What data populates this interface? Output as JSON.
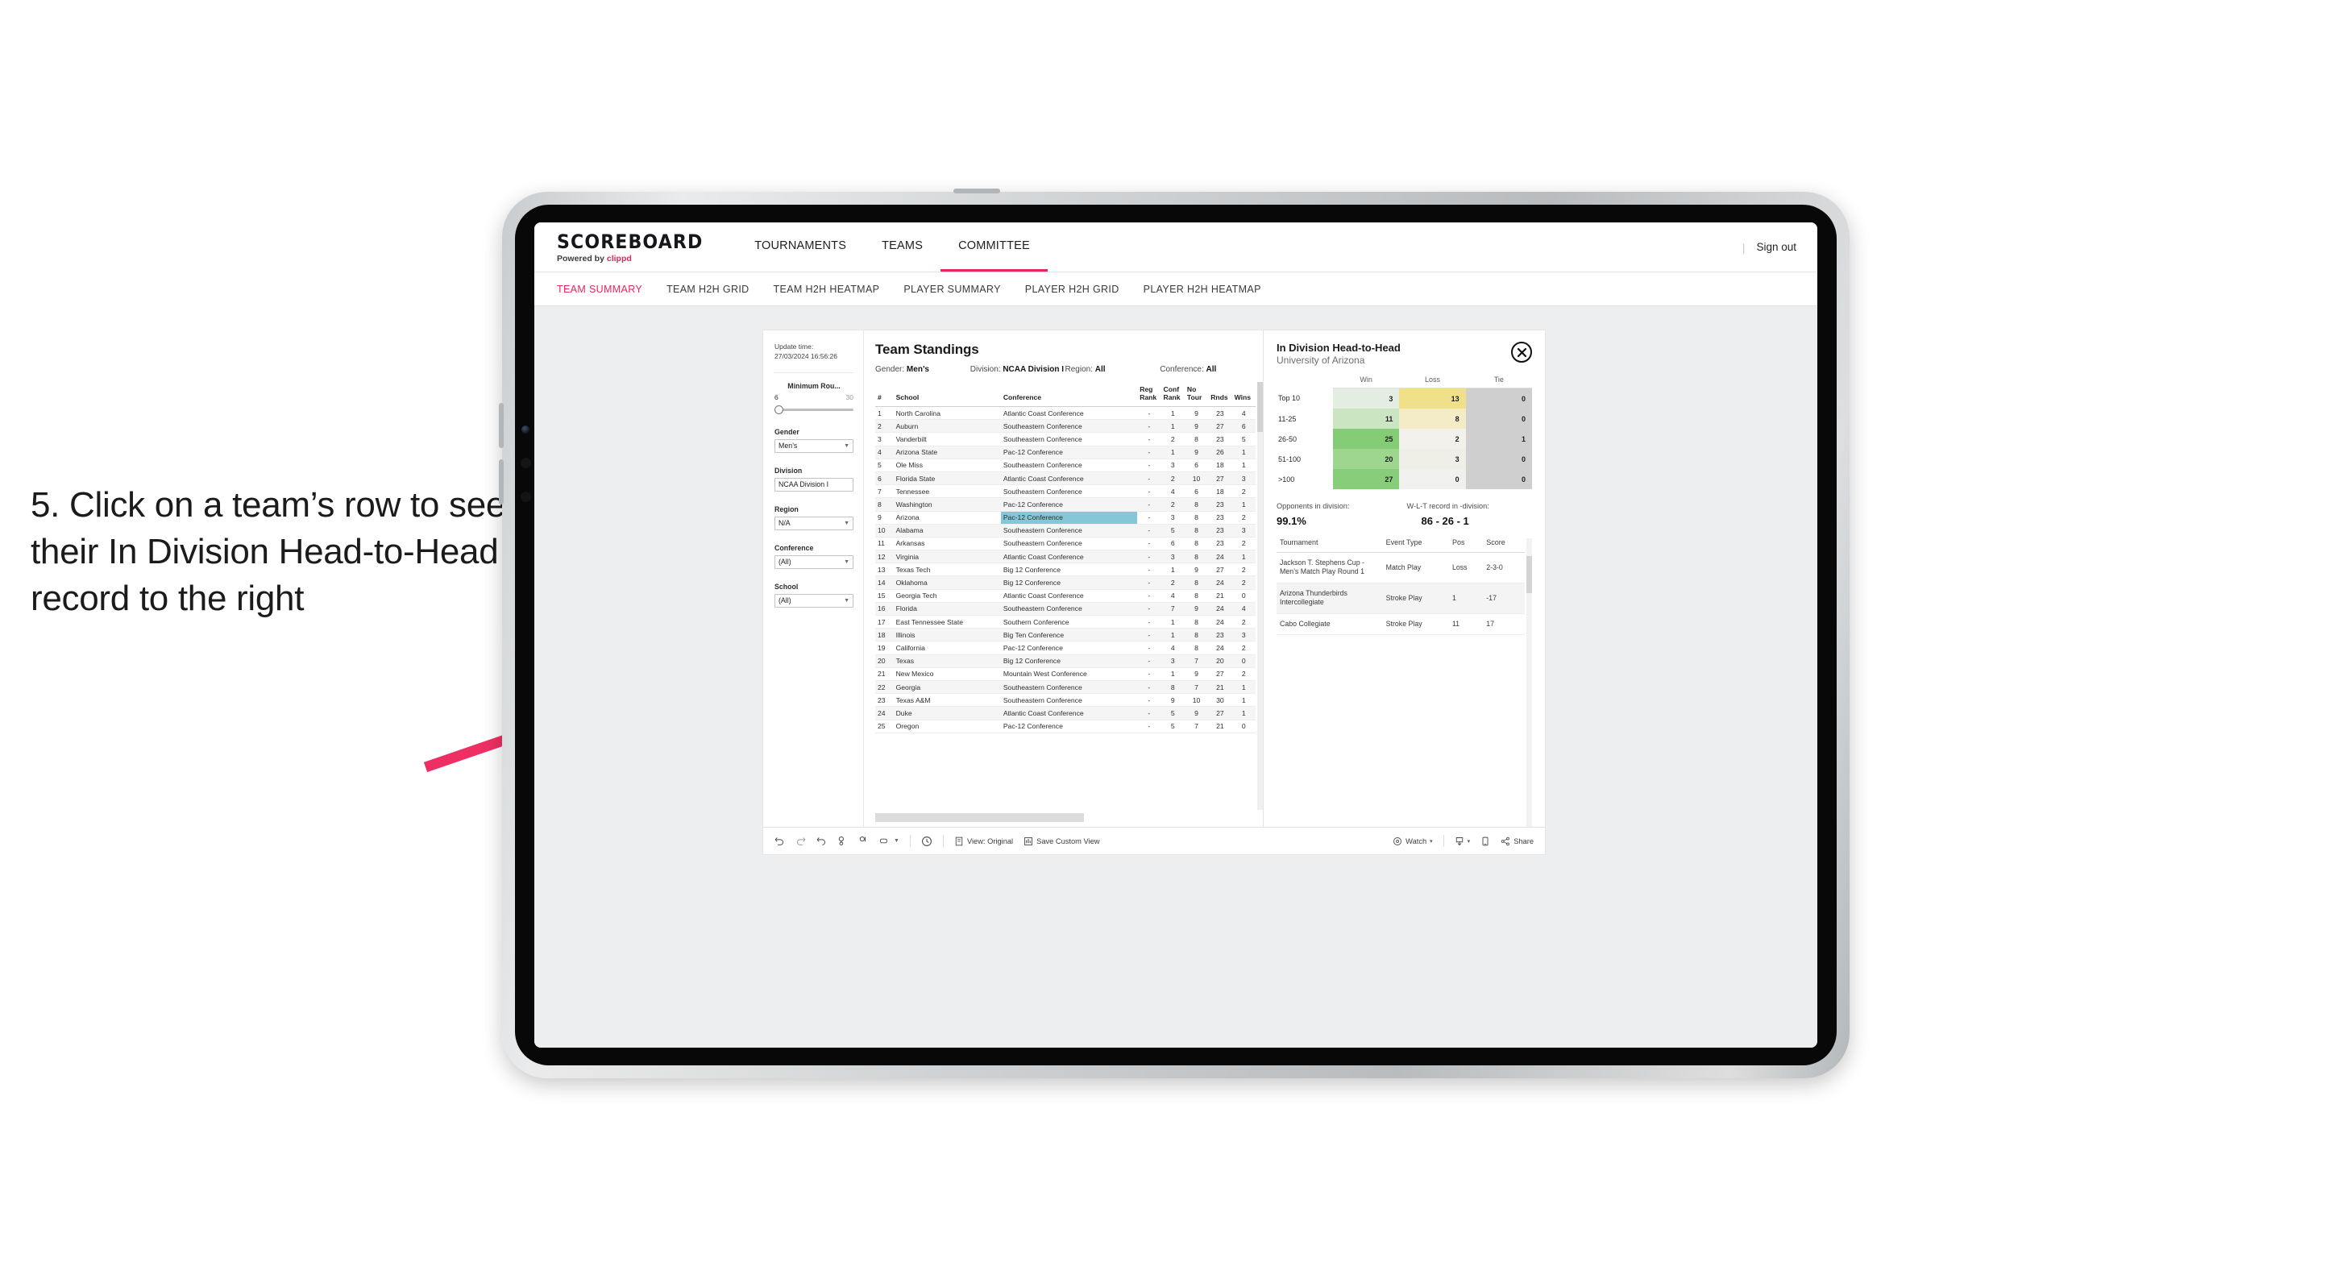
{
  "caption": "5. Click on a team’s row to see their In Division Head-to-Head record to the right",
  "accent_color": "#e8255d",
  "highlight_color": "#84c8d8",
  "header": {
    "brand": "SCOREBOARD",
    "brand_sub_prefix": "Powered by ",
    "brand_sub_name": "clippd",
    "nav": [
      {
        "label": "TOURNAMENTS",
        "active": false
      },
      {
        "label": "TEAMS",
        "active": false
      },
      {
        "label": "COMMITTEE",
        "active": true
      }
    ],
    "divider": "|",
    "sign_out": "Sign out"
  },
  "subnav": [
    {
      "label": "TEAM SUMMARY",
      "active": true
    },
    {
      "label": "TEAM H2H GRID",
      "active": false
    },
    {
      "label": "TEAM H2H HEATMAP",
      "active": false
    },
    {
      "label": "PLAYER SUMMARY",
      "active": false
    },
    {
      "label": "PLAYER H2H GRID",
      "active": false
    },
    {
      "label": "PLAYER H2H HEATMAP",
      "active": false
    }
  ],
  "filters": {
    "update_label": "Update time:",
    "update_value": "27/03/2024 16:56:26",
    "slider": {
      "title": "Minimum Rou...",
      "min": "6",
      "max": "30"
    },
    "selects": [
      {
        "title": "Gender",
        "value": "Men’s"
      },
      {
        "title": "Division",
        "value": "NCAA Division I"
      },
      {
        "title": "Region",
        "value": "N/A"
      },
      {
        "title": "Conference",
        "value": "(All)"
      },
      {
        "title": "School",
        "value": "(All)"
      }
    ]
  },
  "standings": {
    "title": "Team Standings",
    "meta": [
      {
        "label": "Gender:",
        "value": "Men’s"
      },
      {
        "label": "Division:",
        "value": "NCAA Division I"
      },
      {
        "label": "Region:",
        "value": "All"
      },
      {
        "label": "Conference:",
        "value": "All"
      }
    ],
    "columns": [
      "#",
      "School",
      "Conference",
      "Reg Rank",
      "Conf Rank",
      "No Tour",
      "Rnds",
      "Wins"
    ],
    "rows": [
      {
        "rank": "1",
        "school": "North Carolina",
        "conference": "Atlantic Coast Conference",
        "reg": "-",
        "conf": "1",
        "notour": "9",
        "rnds": "23",
        "wins": "4"
      },
      {
        "rank": "2",
        "school": "Auburn",
        "conference": "Southeastern Conference",
        "reg": "-",
        "conf": "1",
        "notour": "9",
        "rnds": "27",
        "wins": "6"
      },
      {
        "rank": "3",
        "school": "Vanderbilt",
        "conference": "Southeastern Conference",
        "reg": "-",
        "conf": "2",
        "notour": "8",
        "rnds": "23",
        "wins": "5"
      },
      {
        "rank": "4",
        "school": "Arizona State",
        "conference": "Pac-12 Conference",
        "reg": "-",
        "conf": "1",
        "notour": "9",
        "rnds": "26",
        "wins": "1"
      },
      {
        "rank": "5",
        "school": "Ole Miss",
        "conference": "Southeastern Conference",
        "reg": "-",
        "conf": "3",
        "notour": "6",
        "rnds": "18",
        "wins": "1"
      },
      {
        "rank": "6",
        "school": "Florida State",
        "conference": "Atlantic Coast Conference",
        "reg": "-",
        "conf": "2",
        "notour": "10",
        "rnds": "27",
        "wins": "3"
      },
      {
        "rank": "7",
        "school": "Tennessee",
        "conference": "Southeastern Conference",
        "reg": "-",
        "conf": "4",
        "notour": "6",
        "rnds": "18",
        "wins": "2"
      },
      {
        "rank": "8",
        "school": "Washington",
        "conference": "Pac-12 Conference",
        "reg": "-",
        "conf": "2",
        "notour": "8",
        "rnds": "23",
        "wins": "1"
      },
      {
        "rank": "9",
        "school": "Arizona",
        "conference": "Pac-12 Conference",
        "reg": "-",
        "conf": "3",
        "notour": "8",
        "rnds": "23",
        "wins": "2",
        "selected": true
      },
      {
        "rank": "10",
        "school": "Alabama",
        "conference": "Southeastern Conference",
        "reg": "-",
        "conf": "5",
        "notour": "8",
        "rnds": "23",
        "wins": "3"
      },
      {
        "rank": "11",
        "school": "Arkansas",
        "conference": "Southeastern Conference",
        "reg": "-",
        "conf": "6",
        "notour": "8",
        "rnds": "23",
        "wins": "2"
      },
      {
        "rank": "12",
        "school": "Virginia",
        "conference": "Atlantic Coast Conference",
        "reg": "-",
        "conf": "3",
        "notour": "8",
        "rnds": "24",
        "wins": "1"
      },
      {
        "rank": "13",
        "school": "Texas Tech",
        "conference": "Big 12 Conference",
        "reg": "-",
        "conf": "1",
        "notour": "9",
        "rnds": "27",
        "wins": "2"
      },
      {
        "rank": "14",
        "school": "Oklahoma",
        "conference": "Big 12 Conference",
        "reg": "-",
        "conf": "2",
        "notour": "8",
        "rnds": "24",
        "wins": "2"
      },
      {
        "rank": "15",
        "school": "Georgia Tech",
        "conference": "Atlantic Coast Conference",
        "reg": "-",
        "conf": "4",
        "notour": "8",
        "rnds": "21",
        "wins": "0"
      },
      {
        "rank": "16",
        "school": "Florida",
        "conference": "Southeastern Conference",
        "reg": "-",
        "conf": "7",
        "notour": "9",
        "rnds": "24",
        "wins": "4"
      },
      {
        "rank": "17",
        "school": "East Tennessee State",
        "conference": "Southern Conference",
        "reg": "-",
        "conf": "1",
        "notour": "8",
        "rnds": "24",
        "wins": "2"
      },
      {
        "rank": "18",
        "school": "Illinois",
        "conference": "Big Ten Conference",
        "reg": "-",
        "conf": "1",
        "notour": "8",
        "rnds": "23",
        "wins": "3"
      },
      {
        "rank": "19",
        "school": "California",
        "conference": "Pac-12 Conference",
        "reg": "-",
        "conf": "4",
        "notour": "8",
        "rnds": "24",
        "wins": "2"
      },
      {
        "rank": "20",
        "school": "Texas",
        "conference": "Big 12 Conference",
        "reg": "-",
        "conf": "3",
        "notour": "7",
        "rnds": "20",
        "wins": "0"
      },
      {
        "rank": "21",
        "school": "New Mexico",
        "conference": "Mountain West Conference",
        "reg": "-",
        "conf": "1",
        "notour": "9",
        "rnds": "27",
        "wins": "2"
      },
      {
        "rank": "22",
        "school": "Georgia",
        "conference": "Southeastern Conference",
        "reg": "-",
        "conf": "8",
        "notour": "7",
        "rnds": "21",
        "wins": "1"
      },
      {
        "rank": "23",
        "school": "Texas A&M",
        "conference": "Southeastern Conference",
        "reg": "-",
        "conf": "9",
        "notour": "10",
        "rnds": "30",
        "wins": "1"
      },
      {
        "rank": "24",
        "school": "Duke",
        "conference": "Atlantic Coast Conference",
        "reg": "-",
        "conf": "5",
        "notour": "9",
        "rnds": "27",
        "wins": "1"
      },
      {
        "rank": "25",
        "school": "Oregon",
        "conference": "Pac-12 Conference",
        "reg": "-",
        "conf": "5",
        "notour": "7",
        "rnds": "21",
        "wins": "0"
      }
    ]
  },
  "h2h": {
    "title": "In Division Head-to-Head",
    "subtitle": "University of Arizona",
    "close_icon": "close-circle-icon",
    "columns": [
      "",
      "Win",
      "Loss",
      "Tie"
    ],
    "rows": [
      {
        "label": "Top 10",
        "win": "3",
        "loss": "13",
        "tie": "0",
        "win_color": "#e3ede2",
        "loss_color": "#f0e08a",
        "tie_color": "#cfcfcf"
      },
      {
        "label": "11-25",
        "win": "11",
        "loss": "8",
        "tie": "0",
        "win_color": "#cbe5c2",
        "loss_color": "#f4ecc6",
        "tie_color": "#cfcfcf"
      },
      {
        "label": "26-50",
        "win": "25",
        "loss": "2",
        "tie": "1",
        "win_color": "#85cc76",
        "loss_color": "#f2f1ec",
        "tie_color": "#cfcfcf"
      },
      {
        "label": "51-100",
        "win": "20",
        "loss": "3",
        "tie": "0",
        "win_color": "#9fd68f",
        "loss_color": "#efeee7",
        "tie_color": "#cfcfcf"
      },
      {
        "label": ">100",
        "win": "27",
        "loss": "0",
        "tie": "0",
        "win_color": "#88cd79",
        "loss_color": "#f0f0ef",
        "tie_color": "#cfcfcf"
      }
    ],
    "kpis": [
      {
        "label": "Opponents in division:",
        "value": "99.1%"
      },
      {
        "label": "W-L-T record in -division:",
        "value": "86 - 26 - 1"
      }
    ],
    "tournament_columns": [
      "Tournament",
      "Event Type",
      "Pos",
      "Score"
    ],
    "tournaments": [
      {
        "name": "Jackson T. Stephens Cup - Men’s Match Play Round 1",
        "type": "Match Play",
        "pos": "Loss",
        "score": "2-3-0"
      },
      {
        "name": "Arizona Thunderbirds Intercollegiate",
        "type": "Stroke Play",
        "pos": "1",
        "score": "-17"
      },
      {
        "name": "Cabo Collegiate",
        "type": "Stroke Play",
        "pos": "11",
        "score": "17"
      }
    ]
  },
  "toolbar": {
    "left_icons": [
      "undo-icon",
      "redo-icon",
      "revert-icon",
      "refresh-icon",
      "pause-icon",
      "rect-select-icon",
      "caret-down-icon"
    ],
    "clock_icon": "clock-icon",
    "view_label": "View: Original",
    "view_icon": "view-icon",
    "save_label": "Save Custom View",
    "save_icon": "save-view-icon",
    "watch_label": "Watch",
    "watch_icon": "watch-icon",
    "watch_caret": "▾",
    "download_icon": "download-icon",
    "download_caret": "▾",
    "device_icon": "device-layout-icon",
    "share_label": "Share",
    "share_icon": "share-icon"
  }
}
